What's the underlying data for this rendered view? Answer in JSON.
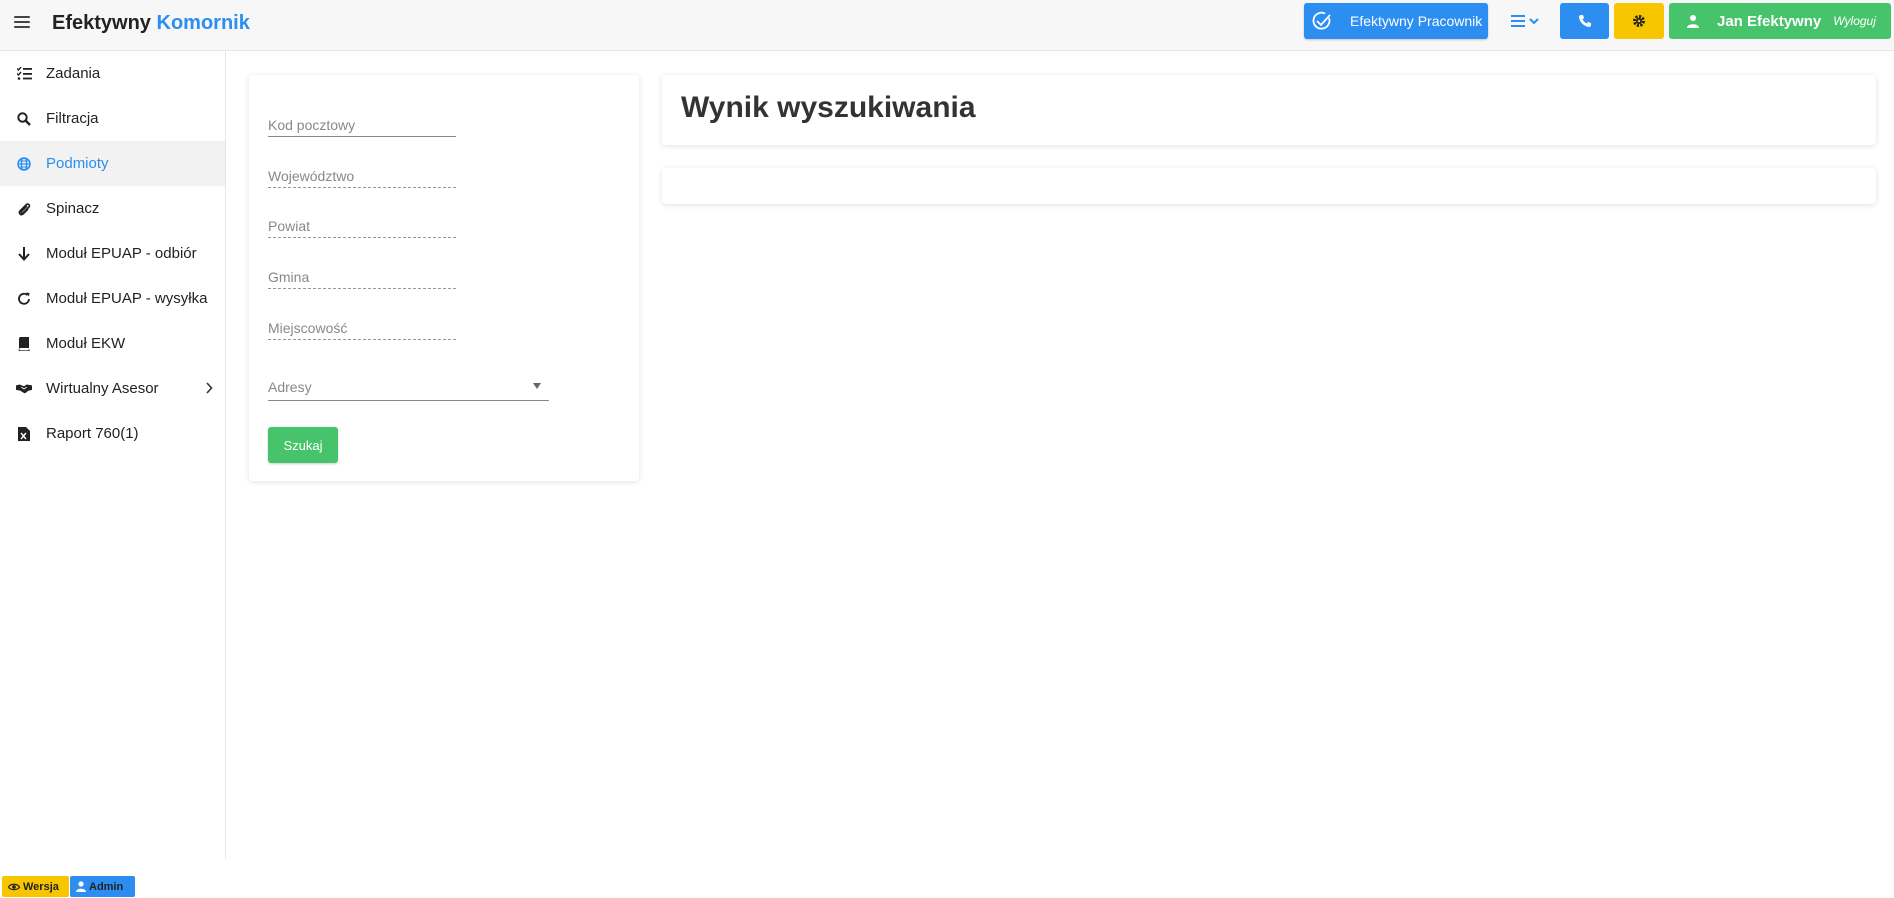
{
  "header": {
    "brand_main": "Efektywny",
    "brand_accent": "Komornik",
    "pracownik_label": "Efektywny Pracownik",
    "user_name": "Jan Efektywny",
    "logout_label": "Wyloguj"
  },
  "sidebar": {
    "items": [
      {
        "label": "Zadania",
        "icon": "task-list-icon"
      },
      {
        "label": "Filtracja",
        "icon": "search-icon"
      },
      {
        "label": "Podmioty",
        "icon": "globe-icon",
        "active": true
      },
      {
        "label": "Spinacz",
        "icon": "paperclip-icon"
      },
      {
        "label": "Moduł EPUAP - odbiór",
        "icon": "arrow-down-icon"
      },
      {
        "label": "Moduł EPUAP - wysyłka",
        "icon": "refresh-icon"
      },
      {
        "label": "Moduł EKW",
        "icon": "book-icon"
      },
      {
        "label": "Wirtualny Asesor",
        "icon": "handshake-icon"
      },
      {
        "label": "Raport 760(1)",
        "icon": "excel-file-icon"
      }
    ]
  },
  "form": {
    "kod_pocztowy_placeholder": "Kod pocztowy",
    "wojewodztwo_placeholder": "Województwo",
    "powiat_placeholder": "Powiat",
    "gmina_placeholder": "Gmina",
    "miejscowosc_placeholder": "Miejscowość",
    "adresy_label": "Adresy",
    "search_label": "Szukaj"
  },
  "results": {
    "title": "Wynik wyszukiwania"
  },
  "footer": {
    "version_label": "Wersja",
    "admin_label": "Admin"
  },
  "colors": {
    "primary": "#2b8ef0",
    "success": "#47c46b",
    "warning": "#f7c600"
  }
}
